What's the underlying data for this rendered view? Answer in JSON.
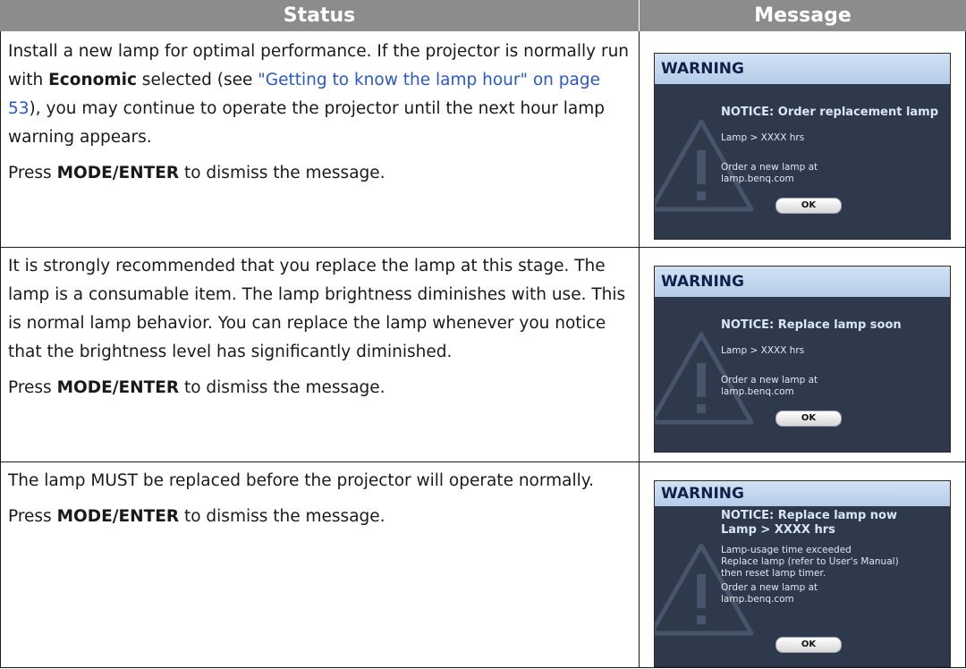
{
  "table": {
    "headers": {
      "status": "Status",
      "message": "Message"
    },
    "rows": [
      {
        "status": {
          "p1_before": "Install a new lamp for optimal performance. If the projector is normally run with ",
          "p1_bold": "Economic",
          "p1_mid": " selected (see ",
          "p1_link": "\"Getting to know the lamp hour\" on page 53",
          "p1_after": "), you may continue to operate the projector until the next hour lamp warning appears.",
          "p2_before": "Press ",
          "p2_bold": "MODE/ENTER",
          "p2_after": " to dismiss the message."
        },
        "message": {
          "title": "WARNING",
          "notice": "NOTICE: Order replacement lamp",
          "lamp_hours": "Lamp > XXXX hrs",
          "order_line1": "Order a new lamp at",
          "order_line2": "lamp.benq.com",
          "ok": "OK"
        }
      },
      {
        "status": {
          "p1": "It is strongly recommended that you replace the lamp at this stage. The lamp is a consumable item. The lamp brightness diminishes with use. This is normal lamp behavior. You can replace the lamp whenever you notice that the brightness level has significantly diminished.",
          "p2_before": "Press ",
          "p2_bold": "MODE/ENTER",
          "p2_after": " to dismiss the message."
        },
        "message": {
          "title": "WARNING",
          "notice": "NOTICE: Replace lamp soon",
          "lamp_hours": "Lamp > XXXX hrs",
          "order_line1": "Order a new lamp at",
          "order_line2": "lamp.benq.com",
          "ok": "OK"
        }
      },
      {
        "status": {
          "p1": "The lamp MUST be replaced before the projector will operate normally.",
          "p2_before": "Press ",
          "p2_bold": "MODE/ENTER",
          "p2_after": " to dismiss the message."
        },
        "message": {
          "title": "WARNING",
          "notice_line1": "NOTICE: Replace lamp now",
          "notice_line2": "Lamp > XXXX hrs",
          "detail1": "Lamp-usage time exceeded",
          "detail2": "Replace lamp (refer to User's Manual)",
          "detail3": "then reset lamp timer.",
          "order_line1": "Order a new lamp at",
          "order_line2": "lamp.benq.com",
          "ok": "OK"
        }
      }
    ]
  },
  "colors": {
    "header_bg": "#8c8c8c",
    "dialog_bg": "#2e3a4c",
    "dialog_title_bg": "#c4d7ee",
    "link": "#2a58c8"
  },
  "icons": {
    "dialog_background": "warning-triangle-icon"
  }
}
